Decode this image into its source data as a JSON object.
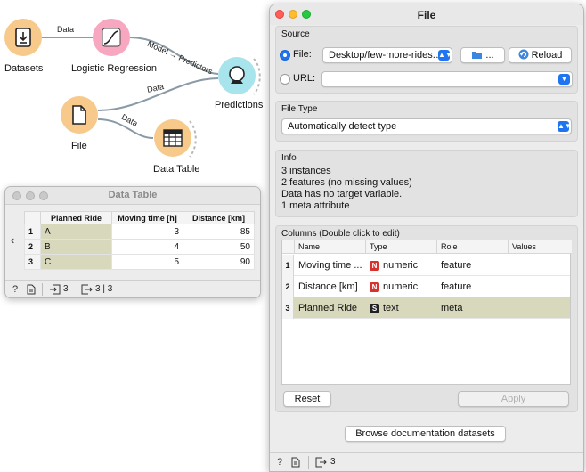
{
  "canvas": {
    "nodes": {
      "datasets": "Datasets",
      "logistic_regression": "Logistic Regression",
      "predictions": "Predictions",
      "file": "File",
      "data_table": "Data Table"
    },
    "links": {
      "datasets_to_lr": "Data",
      "lr_to_predictions": "Model → Predictors",
      "file_to_predictions": "Data",
      "file_to_table": "Data"
    },
    "colors": {
      "datasets": "#f7c98a",
      "logistic_regression": "#f7a7c0",
      "predictions": "#a8e4ec",
      "file": "#f7c98a",
      "data_table": "#f7c98a",
      "link": "#8a9aa6"
    }
  },
  "data_table_window": {
    "title": "Data Table",
    "columns": [
      "Planned Ride",
      "Moving time [h]",
      "Distance [km]"
    ],
    "rows": [
      {
        "num": "1",
        "ride": "A",
        "time": "3",
        "dist": "85"
      },
      {
        "num": "2",
        "ride": "B",
        "time": "4",
        "dist": "50"
      },
      {
        "num": "3",
        "ride": "C",
        "time": "5",
        "dist": "90"
      }
    ],
    "status": {
      "input": "3",
      "output": "3 | 3"
    }
  },
  "file_window": {
    "title": "File",
    "source": {
      "title": "Source",
      "file_label": "File:",
      "file_path": "Desktop/few-more-rides.…",
      "browse_label": "...",
      "reload_label": "Reload",
      "url_label": "URL:",
      "url_value": ""
    },
    "file_type": {
      "title": "File Type",
      "value": "Automatically detect type"
    },
    "info": {
      "title": "Info",
      "lines": [
        "3 instances",
        "2 features (no missing values)",
        "Data has no target variable.",
        "1 meta attribute"
      ]
    },
    "columns": {
      "title": "Columns (Double click to edit)",
      "headers": [
        "Name",
        "Type",
        "Role",
        "Values"
      ],
      "rows": [
        {
          "num": "1",
          "name": "Moving time ...",
          "type_badge": "N",
          "type": "numeric",
          "role": "feature",
          "values": ""
        },
        {
          "num": "2",
          "name": "Distance [km]",
          "type_badge": "N",
          "type": "numeric",
          "role": "feature",
          "values": ""
        },
        {
          "num": "3",
          "name": "Planned Ride",
          "type_badge": "S",
          "type": "text",
          "role": "meta",
          "values": ""
        }
      ],
      "reset_label": "Reset",
      "apply_label": "Apply"
    },
    "browse_docs_label": "Browse documentation datasets",
    "status": {
      "output": "3"
    }
  }
}
